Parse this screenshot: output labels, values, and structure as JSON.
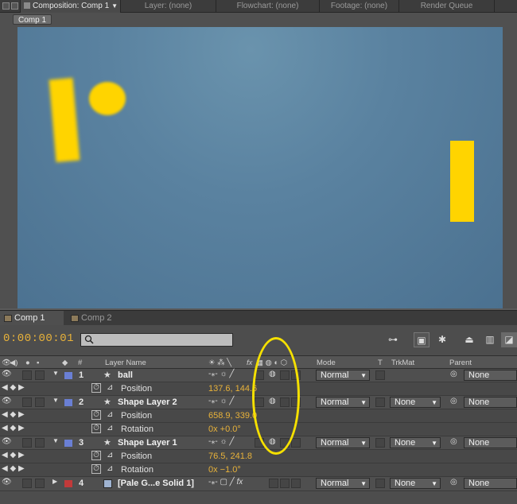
{
  "panel_tabs": [
    {
      "label": "Composition: Comp 1",
      "active": true
    },
    {
      "label": "Layer: (none)"
    },
    {
      "label": "Flowchart: (none)"
    },
    {
      "label": "Footage: (none)"
    },
    {
      "label": "Render Queue"
    }
  ],
  "viewer": {
    "comp_chip": "Comp 1"
  },
  "timeline": {
    "tabs": [
      {
        "label": "Comp 1",
        "active": true
      },
      {
        "label": "Comp 2"
      }
    ],
    "timecode": "0:00:00:01",
    "search_value": ""
  },
  "columns": {
    "number": "#",
    "layer_name": "Layer Name",
    "mode": "Mode",
    "t": "T",
    "trkmat": "TrkMat",
    "parent": "Parent",
    "fx": "fx"
  },
  "layers": [
    {
      "number": "1",
      "name": "ball",
      "mode": "Normal",
      "trkmat": "",
      "parent": "None",
      "color": "#6a7fd4",
      "props": [
        {
          "name": "Position",
          "value": "137.6, 144.6"
        }
      ]
    },
    {
      "number": "2",
      "name": "Shape Layer 2",
      "mode": "Normal",
      "trkmat": "None",
      "parent": "None",
      "color": "#6a7fd4",
      "props": [
        {
          "name": "Position",
          "value": "658.9, 339.0"
        },
        {
          "name": "Rotation",
          "value": "0x +0.0°"
        }
      ]
    },
    {
      "number": "3",
      "name": "Shape Layer 1",
      "mode": "Normal",
      "trkmat": "None",
      "parent": "None",
      "color": "#6a7fd4",
      "props": [
        {
          "name": "Position",
          "value": "76.5, 241.8"
        },
        {
          "name": "Rotation",
          "value": "0x −1.0°"
        }
      ]
    },
    {
      "number": "4",
      "name": "[Pale G...e Solid 1]",
      "mode": "Normal",
      "trkmat": "None",
      "parent": "None",
      "color": "#c23a3a"
    }
  ],
  "colors": {
    "accent_timecode": "#e8b23a",
    "highlight": "#f5e000",
    "shape_fill": "#ffd400"
  }
}
